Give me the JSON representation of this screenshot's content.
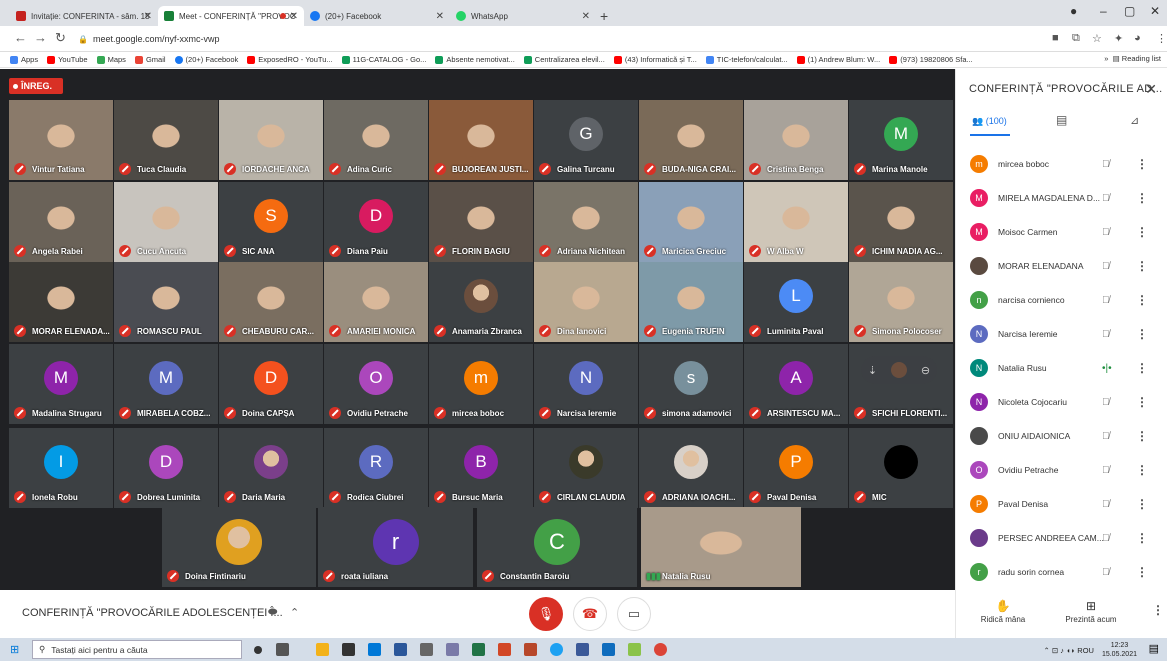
{
  "browser": {
    "tabs": [
      {
        "title": "Invitație: CONFERINTA - sâm. 15",
        "color": "#c5221f"
      },
      {
        "title": "Meet - CONFERINȚĂ \"PROVOC",
        "color": "#188038"
      },
      {
        "title": "(20+) Facebook",
        "color": "#1877f2"
      },
      {
        "title": "WhatsApp",
        "color": "#25d366"
      }
    ],
    "url": "meet.google.com/nyf-xxmc-vwp",
    "bookmarks": [
      "Apps",
      "YouTube",
      "Maps",
      "Gmail",
      "(20+) Facebook",
      "ExposedRO - YouTu...",
      "11G-CATALOG - Go...",
      "Absente nemotivat...",
      "Centralizarea elevil...",
      "(43) Informatică și T...",
      "TIC-telefon/calculat...",
      "(1) Andrew Blum: W...",
      "(973) 19820806 Sfa..."
    ],
    "reading_list": "Reading list"
  },
  "meet": {
    "rec_label": "ÎNREG.",
    "tiles": [
      {
        "name": "Vintur Tatiana",
        "type": "photo",
        "bg": "#8a7a6a"
      },
      {
        "name": "Tuca Claudia",
        "type": "photo",
        "bg": "#4d4a45"
      },
      {
        "name": "IORDACHE ANCA",
        "type": "photo",
        "bg": "#b9b3a8"
      },
      {
        "name": "Adina Curic",
        "type": "photo",
        "bg": "#6e6a62"
      },
      {
        "name": "BUJOREAN JUSTI...",
        "type": "photo",
        "bg": "#8a5a3a"
      },
      {
        "name": "Galina Turcanu",
        "type": "avatar",
        "letter": "G",
        "color": "#5f6368"
      },
      {
        "name": "BUDA-NIGA CRAI...",
        "type": "photo",
        "bg": "#7a6a58"
      },
      {
        "name": "Cristina Benga",
        "type": "photo",
        "bg": "#a8a29a"
      },
      {
        "name": "Marina Manole",
        "type": "avatar",
        "letter": "M",
        "color": "#34a853"
      },
      {
        "name": "Angela Rabei",
        "type": "photo",
        "bg": "#6a6258"
      },
      {
        "name": "Cucu Ancuta",
        "type": "photo",
        "bg": "#c8c4be"
      },
      {
        "name": "SIC ANA",
        "type": "avatar",
        "letter": "S",
        "color": "#f56b10"
      },
      {
        "name": "Diana Paiu",
        "type": "avatar",
        "letter": "D",
        "color": "#d81b60"
      },
      {
        "name": "FLORIN BAGIU",
        "type": "photo",
        "bg": "#5a5048"
      },
      {
        "name": "Adriana Nichitean",
        "type": "photo",
        "bg": "#7a7468"
      },
      {
        "name": "Maricica Greciuc",
        "type": "photo",
        "bg": "#8aa0b8"
      },
      {
        "name": "W Alba W",
        "type": "photo",
        "bg": "#cfc6b8"
      },
      {
        "name": "ICHIM NADIA AG...",
        "type": "photo",
        "bg": "#5a544c"
      },
      {
        "name": "MORAR ELENADA...",
        "type": "photo",
        "bg": "#3c3a36"
      },
      {
        "name": "ROMASCU PAUL",
        "type": "photo",
        "bg": "#4a4c52"
      },
      {
        "name": "CHEABURU CAR...",
        "type": "photo",
        "bg": "#7a6e60"
      },
      {
        "name": "AMARIEI MONICA",
        "type": "photo",
        "bg": "#9a8e7e"
      },
      {
        "name": "Anamaria Zbranca",
        "type": "photo-avatar",
        "color": "#6b4e3d"
      },
      {
        "name": "Dina Ianovici",
        "type": "photo",
        "bg": "#b8a890"
      },
      {
        "name": "Eugenia TRUFIN",
        "type": "photo",
        "bg": "#7e9aa8"
      },
      {
        "name": "Luminita Paval",
        "type": "avatar",
        "letter": "L",
        "color": "#4c8bf5"
      },
      {
        "name": "Simona Polocoser",
        "type": "photo",
        "bg": "#b0a696"
      },
      {
        "name": "Madalina Strugaru",
        "type": "avatar",
        "letter": "M",
        "color": "#8e24aa"
      },
      {
        "name": "MIRABELA COBZ...",
        "type": "avatar",
        "letter": "M",
        "color": "#5c6bc0"
      },
      {
        "name": "Doina CAPȘA",
        "type": "avatar",
        "letter": "D",
        "color": "#f4511e"
      },
      {
        "name": "Ovidiu Petrache",
        "type": "avatar",
        "letter": "O",
        "color": "#ab47bc"
      },
      {
        "name": "mircea boboc",
        "type": "avatar",
        "letter": "m",
        "color": "#f57c00"
      },
      {
        "name": "Narcisa Ieremie",
        "type": "avatar",
        "letter": "N",
        "color": "#5c6bc0"
      },
      {
        "name": "simona adamovici",
        "type": "avatar",
        "letter": "s",
        "color": "#78909c"
      },
      {
        "name": "ARSINTESCU MA...",
        "type": "avatar",
        "letter": "A",
        "color": "#8e24aa"
      },
      {
        "name": "SFICHI FLORENTI...",
        "type": "pinned",
        "color": "#6b4e3d"
      },
      {
        "name": "Ionela Robu",
        "type": "avatar",
        "letter": "I",
        "color": "#039be5"
      },
      {
        "name": "Dobrea Luminita",
        "type": "avatar",
        "letter": "D",
        "color": "#ab47bc"
      },
      {
        "name": "Daria Maria",
        "type": "photo-avatar",
        "color": "#7b3f8a"
      },
      {
        "name": "Rodica Ciubrei",
        "type": "avatar",
        "letter": "R",
        "color": "#5c6bc0"
      },
      {
        "name": "Bursuc Maria",
        "type": "avatar",
        "letter": "B",
        "color": "#8e24aa"
      },
      {
        "name": "CIRLAN CLAUDIA",
        "type": "photo-avatar",
        "color": "#3a3a2a"
      },
      {
        "name": "ADRIANA IOACHI...",
        "type": "photo-avatar",
        "color": "#d8d0c8"
      },
      {
        "name": "Paval Denisa",
        "type": "avatar",
        "letter": "P",
        "color": "#f57c00"
      },
      {
        "name": "MIC",
        "type": "avatar",
        "letter": "",
        "color": "#000000"
      }
    ],
    "bottom_tiles": [
      {
        "name": "Doina Fintinariu",
        "type": "photo-avatar",
        "color": "#e0a020"
      },
      {
        "name": "roata iuliana",
        "type": "avatar",
        "letter": "r",
        "color": "#5e35b1"
      },
      {
        "name": "Constantin Baroiu",
        "type": "avatar",
        "letter": "C",
        "color": "#43a047"
      },
      {
        "name": "Natalia Rusu",
        "type": "speaker",
        "bg": "#a89a8a"
      }
    ],
    "meeting_title": "CONFERINȚĂ \"PROVOCĂRILE ADOLESCENȚEI Î..."
  },
  "panel": {
    "title": "CONFERINȚĂ \"PROVOCĂRILE AD...",
    "count": "(100)",
    "participants": [
      {
        "name": "mircea boboc",
        "letter": "m",
        "color": "#f57c00",
        "speaking": false
      },
      {
        "name": "MIRELA MAGDALENA D...",
        "letter": "M",
        "color": "#e91e63",
        "speaking": false
      },
      {
        "name": "Moisoc Carmen",
        "letter": "M",
        "color": "#e91e63",
        "speaking": false
      },
      {
        "name": "MORAR ELENADANA",
        "letter": "",
        "color": "#5a4a40",
        "speaking": false
      },
      {
        "name": "narcisa cornienco",
        "letter": "n",
        "color": "#43a047",
        "speaking": false
      },
      {
        "name": "Narcisa Ieremie",
        "letter": "N",
        "color": "#5c6bc0",
        "speaking": false
      },
      {
        "name": "Natalia Rusu",
        "letter": "N",
        "color": "#00897b",
        "speaking": true
      },
      {
        "name": "Nicoleta Cojocariu",
        "letter": "N",
        "color": "#8e24aa",
        "speaking": false
      },
      {
        "name": "ONIU AIDAIONICA",
        "letter": "",
        "color": "#4a4a4a",
        "speaking": false
      },
      {
        "name": "Ovidiu Petrache",
        "letter": "O",
        "color": "#ab47bc",
        "speaking": false
      },
      {
        "name": "Paval Denisa",
        "letter": "P",
        "color": "#f57c00",
        "speaking": false
      },
      {
        "name": "PERSEC ANDREEA CAM...",
        "letter": "",
        "color": "#6a3a8a",
        "speaking": false
      },
      {
        "name": "radu sorin cornea",
        "letter": "r",
        "color": "#43a047",
        "speaking": false
      }
    ],
    "raise_hand": "Ridică mâna",
    "present": "Prezintă acum"
  },
  "taskbar": {
    "search_placeholder": "Tastați aici pentru a căuta",
    "lang": "ROU",
    "time": "12:23",
    "date": "15.05.2021"
  }
}
